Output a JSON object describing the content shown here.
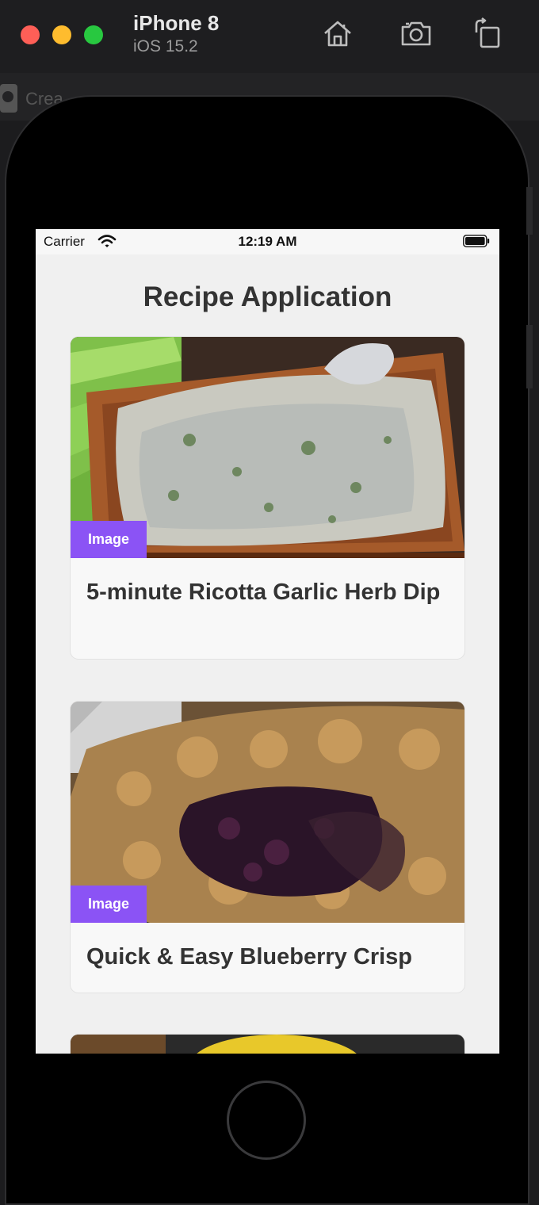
{
  "simulator": {
    "device_name": "iPhone 8",
    "os_version": "iOS 15.2",
    "toolbar": {
      "home_icon": "home-icon",
      "screenshot_icon": "camera-icon",
      "rotate_icon": "rotate-icon"
    },
    "behind_text": "Crea"
  },
  "status_bar": {
    "carrier": "Carrier",
    "time": "12:19 AM"
  },
  "app": {
    "title": "Recipe Application",
    "accent_color": "#8b53f5"
  },
  "recipes": [
    {
      "title": "5-minute Ricotta Garlic Herb Dip",
      "badge": "Image"
    },
    {
      "title": "Quick & Easy Blueberry Crisp",
      "badge": "Image"
    }
  ]
}
